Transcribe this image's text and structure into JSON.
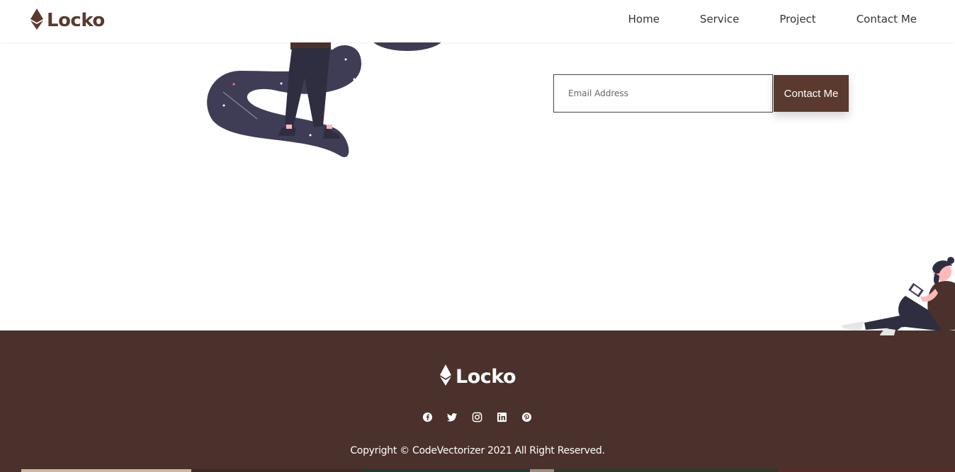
{
  "header": {
    "brand": "Locko",
    "logo_icon": "ethereum-diamond-icon",
    "nav": [
      {
        "label": "Home"
      },
      {
        "label": "Service"
      },
      {
        "label": "Project"
      },
      {
        "label": "Contact Me"
      }
    ]
  },
  "subscribe": {
    "email_placeholder": "Email Address",
    "button_label": "Contact Me"
  },
  "footer": {
    "brand": "Locko",
    "socials": [
      "facebook-icon",
      "twitter-icon",
      "instagram-icon",
      "linkedin-icon",
      "pinterest-icon"
    ],
    "copyright": "Copyright © CodeVectorizer 2021 All Right Reserved."
  },
  "colors": {
    "brand": "#5a3a2e",
    "footer_bg": "#4a312c",
    "illustration_dark": "#3f3d56"
  }
}
